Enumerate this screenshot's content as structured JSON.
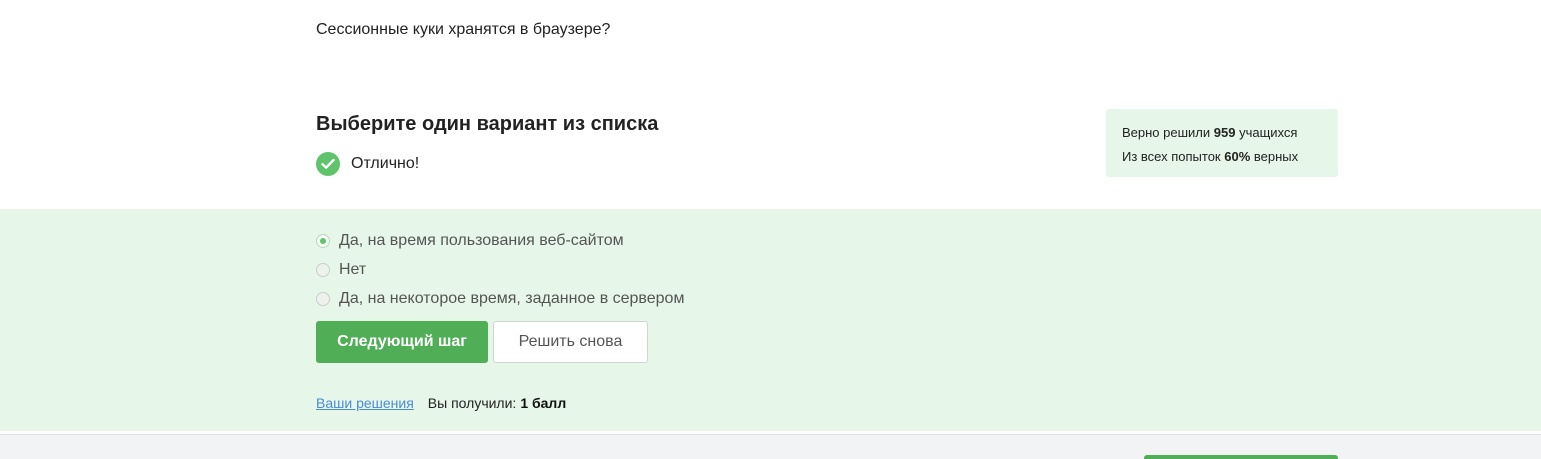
{
  "question": {
    "text": "Сессионные куки хранятся в браузере?"
  },
  "task": {
    "title": "Выберите один вариант из списка",
    "feedback": "Отлично!"
  },
  "stats": {
    "line1_prefix": "Верно решили",
    "solved_count": "959",
    "line1_suffix": "учащихся",
    "line2_prefix": "Из всех попыток",
    "correct_percent": "60%",
    "line2_suffix": "верных"
  },
  "options": [
    {
      "label": "Да, на время пользования веб-сайтом",
      "selected": true
    },
    {
      "label": "Нет",
      "selected": false
    },
    {
      "label": "Да, на некоторое время, заданное в сервером",
      "selected": false
    }
  ],
  "buttons": {
    "next_label": "Следующий шаг",
    "retry_label": "Решить снова"
  },
  "result": {
    "solutions_link": "Ваши решения",
    "score_label": "Вы получили:",
    "score_value": "1 балл"
  },
  "colors": {
    "accent_green": "#4fae56",
    "success_bg": "#e6f6e8",
    "link_blue": "#4a8cd6"
  },
  "icons": {
    "feedback": "check-circle-icon",
    "selected_radio": "radio-checked-icon",
    "unselected_radio": "radio-unchecked-icon"
  }
}
